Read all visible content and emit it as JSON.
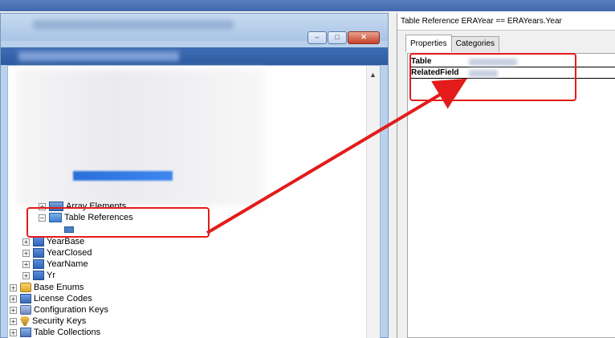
{
  "right_panel": {
    "title": "Table Reference ERAYear == ERAYears.Year",
    "tabs": [
      {
        "label": "Properties",
        "active": true
      },
      {
        "label": "Categories",
        "active": false
      }
    ],
    "properties": [
      {
        "name": "Table"
      },
      {
        "name": "RelatedField"
      }
    ]
  },
  "window": {
    "buttons": {
      "minimize": "–",
      "restore": "□",
      "close": "✕"
    }
  },
  "tree": {
    "array_elements": "Array Elements",
    "table_references": "Table References",
    "fields": [
      {
        "label": "YearBase"
      },
      {
        "label": "YearClosed"
      },
      {
        "label": "YearName"
      },
      {
        "label": "Yr"
      }
    ],
    "root_nodes": [
      {
        "label": "Base Enums",
        "icon": "enum-icon"
      },
      {
        "label": "License Codes",
        "icon": "license-icon"
      },
      {
        "label": "Configuration Keys",
        "icon": "config-icon"
      },
      {
        "label": "Security Keys",
        "icon": "security-key-icon"
      },
      {
        "label": "Table Collections",
        "icon": "table-collection-icon"
      }
    ],
    "expander_collapsed": "+",
    "expander_expanded": "−"
  },
  "annotation": {
    "color": "#e41b1b"
  },
  "colors": {
    "accent_blue": "#3f67ad",
    "selection": "#2b6fd9"
  }
}
